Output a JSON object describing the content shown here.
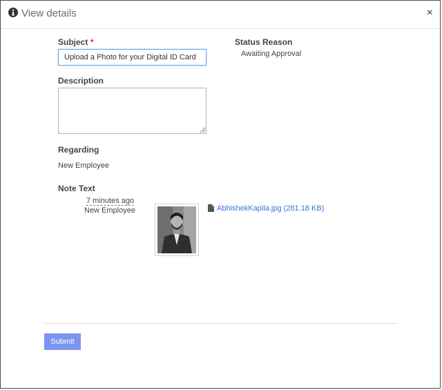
{
  "dialog": {
    "title": "View details",
    "close_glyph": "×",
    "header_icon": "info-icon"
  },
  "form": {
    "subject_label": "Subject",
    "subject_required": "*",
    "subject_value": "Upload a Photo for your Digital ID Card",
    "status_reason_label": "Status Reason",
    "status_reason_value": "Awaiting Approval",
    "description_label": "Description",
    "description_value": "",
    "regarding_label": "Regarding",
    "regarding_value": "New Employee",
    "note_text_label": "Note Text"
  },
  "note": {
    "time_ago": "7 minutes ago",
    "author": "New Employee",
    "attachment_icon": "file-icon",
    "attachment_name": "AbhishekKapila.jpg (281.18 KB)"
  },
  "footer": {
    "submit_label": "Submit"
  },
  "colors": {
    "link": "#3b6fd8",
    "submit_bg": "#7a96ee",
    "required": "#e0281c",
    "focus_border": "#69a3e6"
  }
}
